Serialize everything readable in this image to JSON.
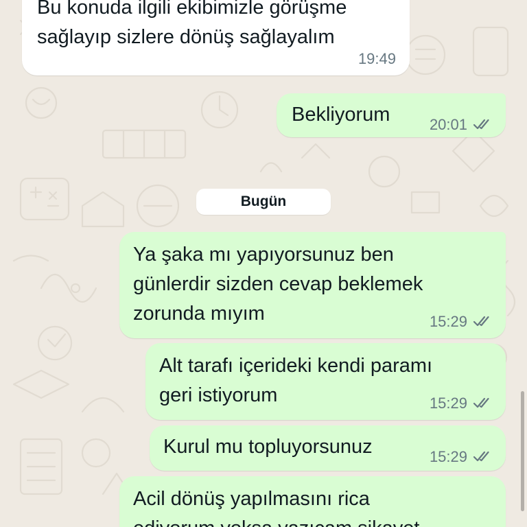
{
  "chat": {
    "date_divider": "Bugün",
    "messages": [
      {
        "direction": "incoming",
        "text": "Bu konuda ilgili ekibimizle görüşme\nsağlayıp sizlere dönüş sağlayalım",
        "time": "19:49"
      },
      {
        "direction": "outgoing",
        "text": "Bekliyorum",
        "time": "20:01",
        "status": "read-ticks-icon"
      },
      {
        "direction": "outgoing",
        "text": "Ya şaka mı yapıyorsunuz ben\ngünlerdir sizden cevap beklemek\nzorunda mıyım",
        "time": "15:29",
        "status": "read-ticks-icon"
      },
      {
        "direction": "outgoing",
        "text": "Alt tarafı içerideki kendi paramı\ngeri istiyorum",
        "time": "15:29",
        "status": "read-ticks-icon"
      },
      {
        "direction": "outgoing",
        "text": "Kurul mu topluyorsunuz",
        "time": "15:29",
        "status": "read-ticks-icon"
      },
      {
        "direction": "outgoing",
        "text": "Acil dönüş yapılmasını rica\nediyorum yoksa yazıcam şikayet",
        "time": "",
        "status": ""
      }
    ]
  },
  "colors": {
    "wallpaper": "#efeae2",
    "incoming_bubble": "#ffffff",
    "outgoing_bubble": "#d9fdd3",
    "text": "#111b21",
    "meta": "#667781"
  }
}
